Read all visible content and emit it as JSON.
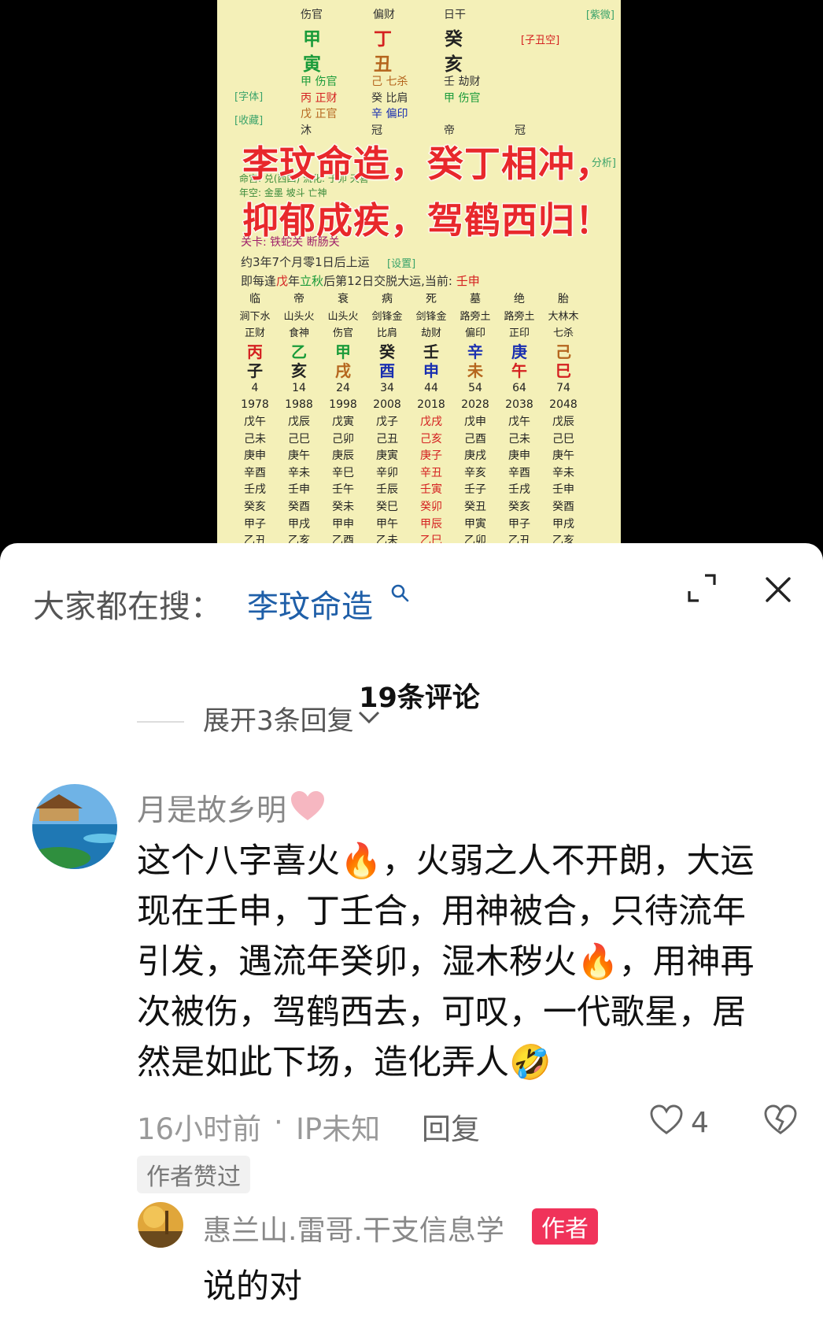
{
  "video": {
    "top_tag": "[紫微]",
    "header_row": [
      "伤官",
      "偏财",
      "日干"
    ],
    "stems": [
      "甲",
      "丁",
      "癸"
    ],
    "branches": [
      "寅",
      "丑",
      "亥"
    ],
    "kong": "[子丑空]",
    "hidden": [
      [
        "甲 伤官",
        "丙 正财",
        "戊 正官"
      ],
      [
        "己 七杀",
        "癸 比肩",
        "辛 偏印"
      ],
      [
        "壬 劫财",
        "甲 伤官",
        ""
      ]
    ],
    "side_tags": [
      "[字体]",
      "[收藏]",
      "分析]"
    ],
    "stages": [
      "沐",
      "冠",
      "帝",
      "冠"
    ],
    "overlay_line1": "李玟命造，癸丁相冲，",
    "overlay_line2": "抑郁成疾，驾鹤西归！",
    "partial_lines": [
      "命宫: 兑(西四)  流化: 于卯  天喜",
      "年空: 金墨  坡斗  亡神"
    ],
    "guan_ka": "关卡: 铁蛇关  断肠关",
    "start_luck": "约3年7个月零1日后上运",
    "setting_tag": "[设置]",
    "jiao_yun_pre": "即每逢",
    "jiao_yun_wu": "戊",
    "jiao_yun_mid": "年",
    "jiao_yun_liqiu": "立秋",
    "jiao_yun_post": "后第12日交脱大运,当前: ",
    "jiao_yun_current": "壬申",
    "luck_columns": [
      {
        "stage": "临",
        "nayin": "涧下水",
        "god": "正财",
        "stem": "丙",
        "branch": "子",
        "age": "4",
        "year": "1978",
        "years": [
          "戊午",
          "己未",
          "庚申",
          "辛酉",
          "壬戌",
          "癸亥",
          "甲子",
          "乙丑"
        ]
      },
      {
        "stage": "帝",
        "nayin": "山头火",
        "god": "食神",
        "stem": "乙",
        "branch": "亥",
        "age": "14",
        "year": "1988",
        "years": [
          "戊辰",
          "己巳",
          "庚午",
          "辛未",
          "壬申",
          "癸酉",
          "甲戌",
          "乙亥"
        ]
      },
      {
        "stage": "衰",
        "nayin": "山头火",
        "god": "伤官",
        "stem": "甲",
        "branch": "戌",
        "age": "24",
        "year": "1998",
        "years": [
          "戊寅",
          "己卯",
          "庚辰",
          "辛巳",
          "壬午",
          "癸未",
          "甲申",
          "乙酉"
        ]
      },
      {
        "stage": "病",
        "nayin": "剑锋金",
        "god": "比肩",
        "stem": "癸",
        "branch": "酉",
        "age": "34",
        "year": "2008",
        "years": [
          "戊子",
          "己丑",
          "庚寅",
          "辛卯",
          "壬辰",
          "癸巳",
          "甲午",
          "乙未"
        ]
      },
      {
        "stage": "死",
        "nayin": "剑锋金",
        "god": "劫财",
        "stem": "壬",
        "branch": "申",
        "age": "44",
        "year": "2018",
        "years": [
          "戊戌",
          "己亥",
          "庚子",
          "辛丑",
          "壬寅",
          "癸卯",
          "甲辰",
          "乙巳"
        ]
      },
      {
        "stage": "墓",
        "nayin": "路旁土",
        "god": "偏印",
        "stem": "辛",
        "branch": "未",
        "age": "54",
        "year": "2028",
        "years": [
          "戊申",
          "己酉",
          "庚戌",
          "辛亥",
          "壬子",
          "癸丑",
          "甲寅",
          "乙卯"
        ]
      },
      {
        "stage": "绝",
        "nayin": "路旁土",
        "god": "正印",
        "stem": "庚",
        "branch": "午",
        "age": "64",
        "year": "2038",
        "years": [
          "戊午",
          "己未",
          "庚申",
          "辛酉",
          "壬戌",
          "癸亥",
          "甲子",
          "乙丑"
        ]
      },
      {
        "stage": "胎",
        "nayin": "大林木",
        "god": "七杀",
        "stem": "己",
        "branch": "巳",
        "age": "74",
        "year": "2048",
        "years": [
          "戊辰",
          "己巳",
          "庚午",
          "辛未",
          "壬申",
          "癸酉",
          "甲戌",
          "乙亥"
        ]
      }
    ]
  },
  "search_bar": {
    "label": "大家都在搜：",
    "term": "李玟命造"
  },
  "comments_header": {
    "title": "19条评论",
    "expand_replies": "展开3条回复"
  },
  "comment": {
    "username": "月是故乡明",
    "text_lines": [
      "这个八字喜火🔥，火弱之人不开朗，大运",
      "现在壬申，丁壬合，用神被合，只待流年",
      "引发，遇流年癸卯，湿木秽火🔥，用神再",
      "次被伤，驾鹤西去，可叹，一代歌星，居",
      "然是如此下场，造化弄人🤣"
    ],
    "time": "16小时前",
    "ip": "IP未知",
    "reply_label": "回复",
    "likes": "4",
    "author_liked": "作者赞过"
  },
  "reply": {
    "username": "惠兰山.雷哥.干支信息学",
    "badge": "作者",
    "text": "说的对"
  },
  "colors": {
    "accent_blue": "#1f5fa8",
    "author_badge": "#f0335a",
    "chart_bg": "#f4f0b8"
  }
}
